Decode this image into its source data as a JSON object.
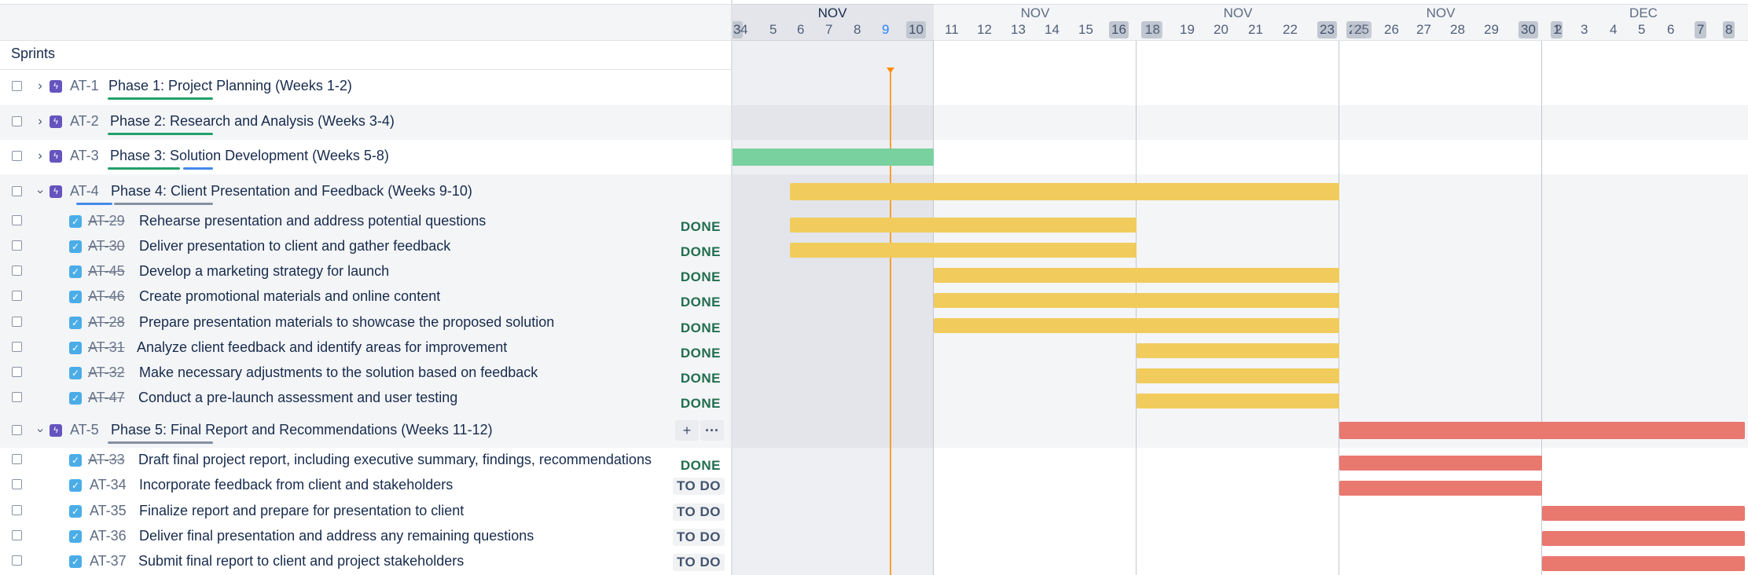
{
  "header": {
    "sprints_label": "Sprints",
    "months": [
      "NOV",
      "NOV",
      "NOV",
      "NOV",
      "DEC"
    ],
    "week1_days": [
      "3",
      "4",
      "5",
      "6",
      "7",
      "8",
      "9",
      "10"
    ],
    "week2_days": [
      "11",
      "12",
      "13",
      "14",
      "15",
      "16",
      "17"
    ],
    "week3_days": [
      "18",
      "19",
      "20",
      "21",
      "22",
      "23",
      "24"
    ],
    "week4_days": [
      "25",
      "26",
      "27",
      "28",
      "29",
      "30",
      "1"
    ],
    "week5_days": [
      "2",
      "3",
      "4",
      "5",
      "6",
      "7",
      "8"
    ],
    "today_day": "9"
  },
  "colors": {
    "green_bar": "#79d19f",
    "yellow_bar": "#f1cc5d",
    "red_bar": "#e9786f",
    "today_line": "#ff8b00",
    "done_status": "#216e4e"
  },
  "epics": [
    {
      "key": "AT-1",
      "title": "Phase 1: Project Planning (Weeks 1-2)",
      "expanded": false
    },
    {
      "key": "AT-2",
      "title": "Phase 2: Research and Analysis (Weeks 3-4)",
      "expanded": false
    },
    {
      "key": "AT-3",
      "title": "Phase 3: Solution Development (Weeks 5-8)",
      "expanded": false
    },
    {
      "key": "AT-4",
      "title": "Phase 4: Client Presentation and Feedback (Weeks 9-10)",
      "expanded": true
    },
    {
      "key": "AT-5",
      "title": "Phase 5: Final Report and Recommendations (Weeks 11-12)",
      "expanded": true
    }
  ],
  "phase4_tasks": [
    {
      "key": "AT-29",
      "title": "Rehearse presentation and address potential questions",
      "status": "DONE"
    },
    {
      "key": "AT-30",
      "title": "Deliver presentation to client and gather feedback",
      "status": "DONE"
    },
    {
      "key": "AT-45",
      "title": "Develop a marketing strategy for launch",
      "status": "DONE"
    },
    {
      "key": "AT-46",
      "title": "Create promotional materials and online content",
      "status": "DONE"
    },
    {
      "key": "AT-28",
      "title": "Prepare presentation materials to showcase the proposed solution",
      "status": "DONE"
    },
    {
      "key": "AT-31",
      "title": "Analyze client feedback and identify areas for improvement",
      "status": "DONE"
    },
    {
      "key": "AT-32",
      "title": "Make necessary adjustments to the solution based on feedback",
      "status": "DONE"
    },
    {
      "key": "AT-47",
      "title": "Conduct a pre-launch assessment and user testing",
      "status": "DONE"
    }
  ],
  "phase5_tasks": [
    {
      "key": "AT-33",
      "title": "Draft final project report, including executive summary, findings, recommendations",
      "status": "DONE"
    },
    {
      "key": "AT-34",
      "title": "Incorporate feedback from client and stakeholders",
      "status": "TO DO"
    },
    {
      "key": "AT-35",
      "title": "Finalize report and prepare for presentation to client",
      "status": "TO DO"
    },
    {
      "key": "AT-36",
      "title": "Deliver final presentation and address any remaining questions",
      "status": "TO DO"
    },
    {
      "key": "AT-37",
      "title": "Submit final report to client and project stakeholders",
      "status": "TO DO"
    }
  ],
  "row_actions": {
    "add": "+",
    "more": "···"
  }
}
